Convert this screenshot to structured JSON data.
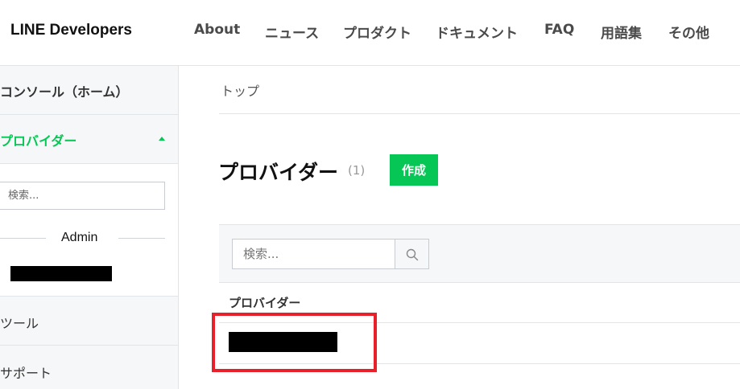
{
  "header": {
    "logo": "LINE Developers",
    "nav": [
      "About",
      "ニュース",
      "プロダクト",
      "ドキュメント",
      "FAQ",
      "用語集",
      "その他"
    ]
  },
  "sidebar": {
    "console": "コンソール（ホーム）",
    "provider": "プロバイダー",
    "search_placeholder": "検索...",
    "group_label": "Admin",
    "tools": "ツール",
    "support": "サポート"
  },
  "main": {
    "breadcrumb": "トップ",
    "title": "プロバイダー",
    "count": "(1)",
    "create_label": "作成",
    "search_placeholder": "検索...",
    "column_header": "プロバイダー"
  },
  "colors": {
    "accent": "#06c755",
    "highlight": "#e8202a"
  }
}
